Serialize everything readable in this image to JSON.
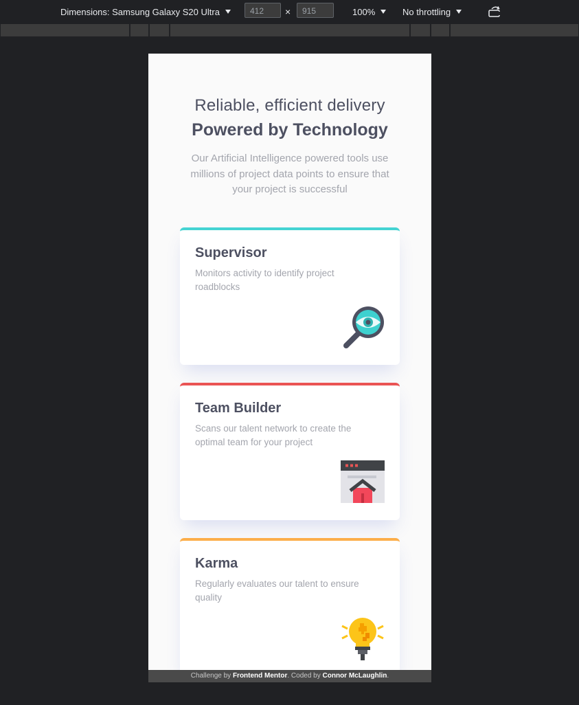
{
  "devtools": {
    "device_label": "Dimensions: Samsung Galaxy S20 Ultra",
    "width_value": "412",
    "height_value": "915",
    "times_symbol": "×",
    "zoom_label": "100%",
    "throttle_label": "No throttling",
    "rotate_icon": "rotate-device-icon"
  },
  "hero": {
    "line1": "Reliable, efficient delivery",
    "line2": "Powered by Technology",
    "description": "Our Artificial Intelligence powered tools use millions of project data points to ensure that your project is successful"
  },
  "cards": [
    {
      "title": "Supervisor",
      "description": "Monitors activity to identify project roadblocks",
      "accent": "#44d3d2",
      "icon": "magnifier-eye-icon"
    },
    {
      "title": "Team Builder",
      "description": "Scans our talent network to create the optimal team for your project",
      "accent": "#ea5454",
      "icon": "browser-house-icon"
    },
    {
      "title": "Karma",
      "description": "Regularly evaluates our talent to ensure quality",
      "accent": "#fcae4a",
      "icon": "lightbulb-puzzle-icon"
    }
  ],
  "footer": {
    "prefix": "Challenge by ",
    "mentor": "Frontend Mentor",
    "middle": ". Coded by ",
    "author": "Connor McLaughlin",
    "suffix": "."
  },
  "colors": {
    "page_bg": "#fafafa",
    "heading": "#4d5061",
    "muted": "#a3a5ad",
    "cyan": "#44d3d2",
    "red": "#ea5454",
    "orange": "#fcae4a"
  }
}
